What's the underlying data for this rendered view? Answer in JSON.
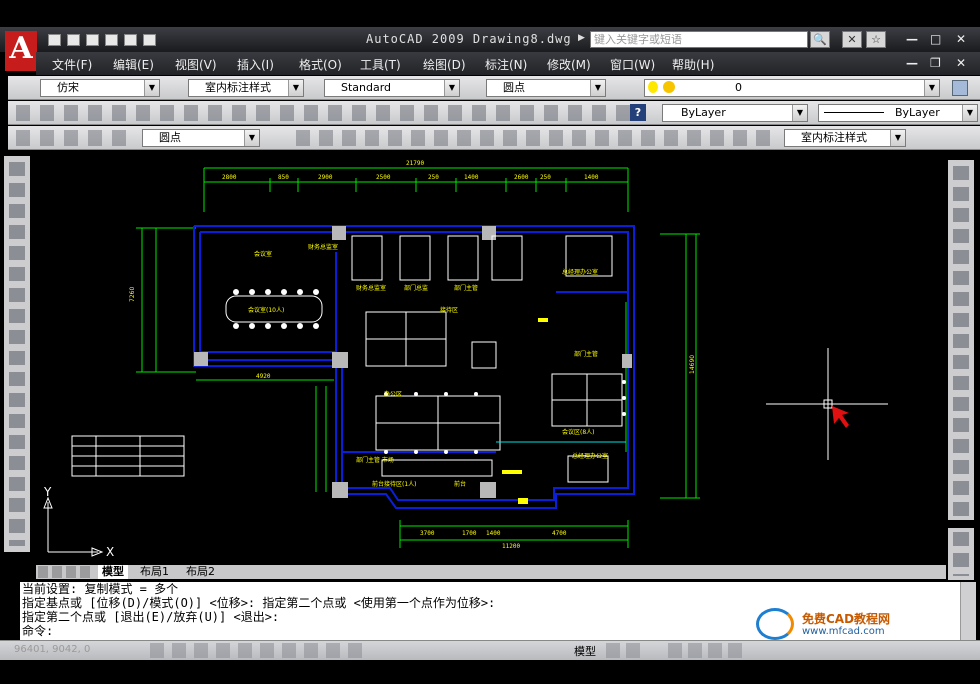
{
  "app": {
    "title": "AutoCAD 2009  Drawing8.dwg",
    "search_placeholder": "键入关键字或短语"
  },
  "menu": [
    "文件(F)",
    "编辑(E)",
    "视图(V)",
    "插入(I)",
    "格式(O)",
    "工具(T)",
    "绘图(D)",
    "标注(N)",
    "修改(M)",
    "窗口(W)",
    "帮助(H)"
  ],
  "toolbar_styles": {
    "font_style": "仿宋",
    "dim_style": "室内标注样式",
    "table_style": "Standard",
    "ml_style": "圆点",
    "layer": "0"
  },
  "toolbar_props": {
    "color": "ByLayer",
    "linetype": "ByLayer"
  },
  "toolbar_dim": {
    "leader_style": "圆点",
    "dim_style": "室内标注样式"
  },
  "layout_tabs": [
    "模型",
    "布局1",
    "布局2"
  ],
  "command_lines": [
    "当前设置:  复制模式 = 多个",
    "指定基点或 [位移(D)/模式(O)] <位移>: 指定第二个点或 <使用第一个点作为位移>:",
    "指定第二个点或 [退出(E)/放弃(U)] <退出>:",
    "命令:"
  ],
  "status": {
    "coords": "96401, 9042, 0",
    "model_label": "模型"
  },
  "watermark": {
    "site": "www.mfcad.com",
    "name": "免费CAD教程网"
  },
  "ucs": {
    "x": "X",
    "y": "Y"
  },
  "drawing": {
    "dims_top": [
      "21790",
      "2800",
      "850",
      "2900",
      "2500",
      "250",
      "1400",
      "2600",
      "250",
      "1400"
    ],
    "dim_bottom_total": "11200",
    "dims_bottom": [
      "3700",
      "1700",
      "1400",
      "4700"
    ],
    "dim_left_total": "7260",
    "dim_right_total": "14690",
    "dim_left_wall": "4920",
    "rooms": [
      {
        "name": "财务总监室"
      },
      {
        "name": "会议室"
      },
      {
        "name": "会议室(10人)"
      },
      {
        "name": "财务总监室"
      },
      {
        "name": "部门总监"
      },
      {
        "name": "部门主管"
      },
      {
        "name": "总经理办公室"
      },
      {
        "name": "接待区"
      },
      {
        "name": "部门主管"
      },
      {
        "name": "办公区"
      },
      {
        "name": "会议区(8人)"
      },
      {
        "name": "部门主管 市场"
      },
      {
        "name": "前台接待区(1人)"
      },
      {
        "name": "前台"
      },
      {
        "name": "总经理办公室"
      }
    ]
  },
  "colors": {
    "canvas": "#000000",
    "wall": "#0a1fd8",
    "dim": "#00e600",
    "furniture": "#ffffff",
    "room_text": "#ffff00",
    "accent": "#00e0e0"
  }
}
